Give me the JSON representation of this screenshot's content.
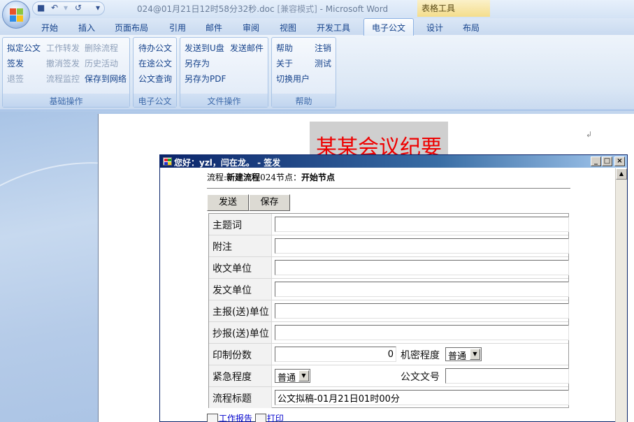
{
  "window": {
    "title": "024@01月21日12时58分32秒.doc",
    "compat": "[兼容模式]",
    "app": "- Microsoft Word",
    "context_tools": "表格工具"
  },
  "tabs": [
    "开始",
    "插入",
    "页面布局",
    "引用",
    "邮件",
    "审阅",
    "视图",
    "开发工具",
    "电子公文",
    "设计",
    "布局"
  ],
  "active_tab": "电子公文",
  "ribbon": {
    "basic": {
      "label": "基础操作",
      "items": [
        "拟定公文",
        "工作转发",
        "删除流程",
        "签发",
        "撤消签发",
        "历史活动",
        "退签",
        "流程监控",
        "保存到网络"
      ]
    },
    "edoc": {
      "label": "电子公文",
      "items": [
        "待办公文",
        "在途公文",
        "公文查询"
      ]
    },
    "file": {
      "label": "文件操作",
      "items": [
        "发送到U盘",
        "发送邮件",
        "另存为",
        "另存为PDF"
      ]
    },
    "help": {
      "label": "帮助",
      "items": [
        "帮助",
        "注销",
        "关于",
        "测试",
        "切换用户"
      ]
    }
  },
  "document": {
    "title": "某某会议纪要"
  },
  "dialog": {
    "title": "您好：yzl，闫在龙。 - 签发",
    "flow_prefix": "流程:",
    "flow_name": "新建流程",
    "node_prefix": "024节点：",
    "node_name": "开始节点",
    "send_label": "发送",
    "save_label": "保存",
    "fields": {
      "subject": {
        "label": "主题词",
        "value": ""
      },
      "note": {
        "label": "附注",
        "value": ""
      },
      "recv_unit": {
        "label": "收文单位",
        "value": ""
      },
      "send_unit": {
        "label": "发文单位",
        "value": ""
      },
      "report_unit": {
        "label": "主报(送)单位",
        "value": ""
      },
      "cc_unit": {
        "label": "抄报(送)单位",
        "value": ""
      },
      "copies": {
        "label": "印制份数",
        "value": "0"
      },
      "secret": {
        "label": "机密程度",
        "value": "普通"
      },
      "urgency": {
        "label": "紧急程度",
        "value": "普通"
      },
      "doc_no": {
        "label": "公文文号",
        "value": ""
      },
      "flow_title": {
        "label": "流程标题",
        "value": "公文拟稿-01月21日01时00分"
      }
    },
    "links": {
      "report": "工作报告",
      "print": "打印"
    }
  }
}
